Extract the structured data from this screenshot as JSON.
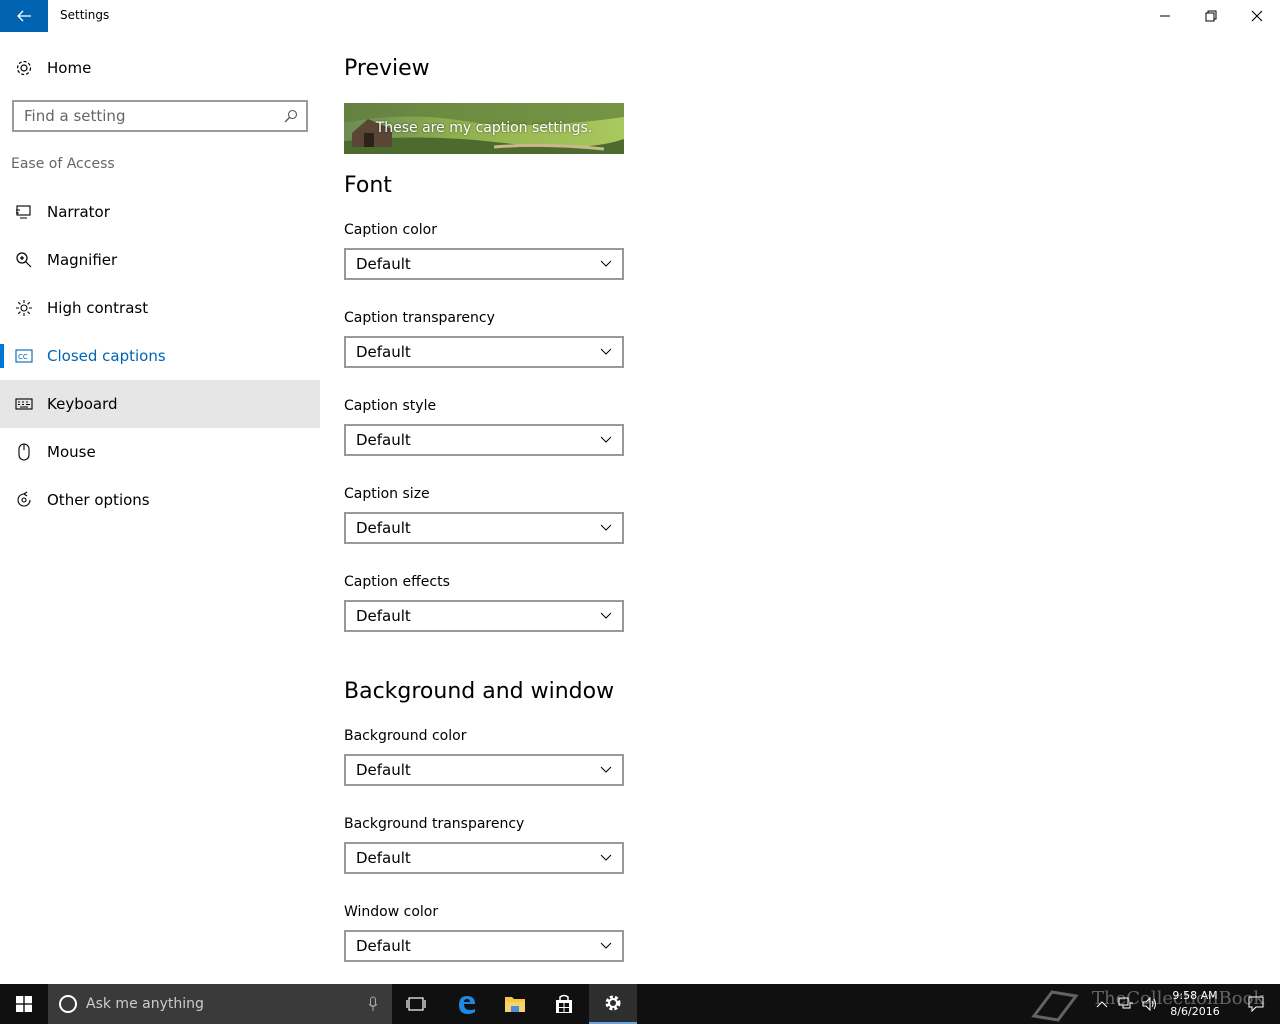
{
  "window": {
    "title": "Settings"
  },
  "sidebar": {
    "home_label": "Home",
    "search_placeholder": "Find a setting",
    "group_label": "Ease of Access",
    "items": [
      {
        "label": "Narrator",
        "icon": "narrator-icon"
      },
      {
        "label": "Magnifier",
        "icon": "magnifier-icon"
      },
      {
        "label": "High contrast",
        "icon": "high-contrast-icon"
      },
      {
        "label": "Closed captions",
        "icon": "closed-captions-icon",
        "selected": true
      },
      {
        "label": "Keyboard",
        "icon": "keyboard-icon",
        "hovered": true
      },
      {
        "label": "Mouse",
        "icon": "mouse-icon"
      },
      {
        "label": "Other options",
        "icon": "other-options-icon"
      }
    ]
  },
  "content": {
    "preview_heading": "Preview",
    "preview_caption": "These are my caption settings.",
    "font_heading": "Font",
    "background_heading": "Background and window",
    "font_fields": [
      {
        "label": "Caption color",
        "value": "Default"
      },
      {
        "label": "Caption transparency",
        "value": "Default"
      },
      {
        "label": "Caption style",
        "value": "Default"
      },
      {
        "label": "Caption size",
        "value": "Default"
      },
      {
        "label": "Caption effects",
        "value": "Default"
      }
    ],
    "background_fields": [
      {
        "label": "Background color",
        "value": "Default"
      },
      {
        "label": "Background transparency",
        "value": "Default"
      },
      {
        "label": "Window color",
        "value": "Default"
      }
    ]
  },
  "taskbar": {
    "search_text": "Ask me anything",
    "time": "9:58 AM",
    "date": "8/6/2016",
    "watermark": "TheCollectionBook"
  },
  "colors": {
    "accent": "#0063b1",
    "selected_bar": "#0078d7",
    "hover": "#e6e6e6",
    "taskbar": "#101010"
  }
}
